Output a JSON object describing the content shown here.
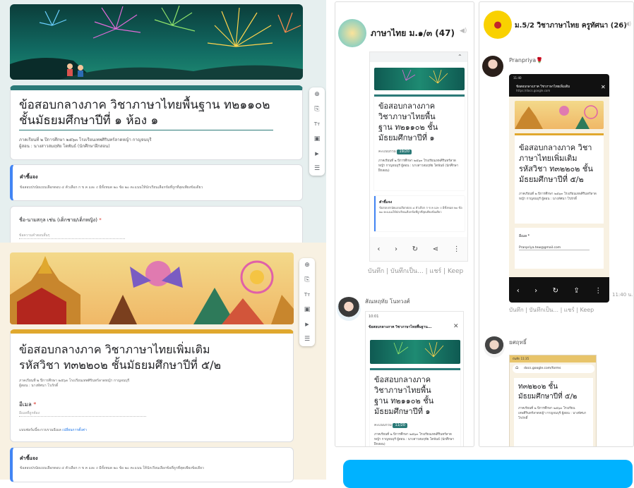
{
  "formA": {
    "title": "ข้อสอบกลางภาค วิชาภาษาไทยพื้นฐาน ท๒๑๑๐๒ ชั้นมัธยมศึกษาปีที่ ๑ ห้อง ๑",
    "title_line1": "ข้อสอบกลางภาค วิชาภาษาไทยพื้นฐาน ท๒๑๑๐๒",
    "title_line2": "ชั้นมัธยมศึกษาปีที่ ๑ ห้อง ๑",
    "desc1": "ภาคเรียนที่ ๒ ปีการศึกษา ๒๕๖๓ โรงเรียนเทพศิรินทร์ลาดหญ้า กาญจนบุรี",
    "desc2": "ผู้สอน : นางสาวสมฤทัย โตพันธ์ (นักศึกษาฝึกสอน)",
    "instr_title": "คำชี้แจง",
    "instr_text": "ข้อสอบปรนัยแบบเลือกตอบ ๔ ตัวเลือก ก ข ค และ ง มีทั้งหมด ๒๐ ข้อ ๒๐ คะแนนให้นักเรียนเลือกข้อที่ถูกที่สุดเพียงข้อเดียว",
    "q1_label": "ชื่อ-นามสกุล เช่น (เด็กชาย/เด็กหญิง)",
    "q1_placeholder": "ข้อความคำตอบสั้นๆ",
    "required_mark": "*"
  },
  "formB": {
    "title_line1": "ข้อสอบกลางภาค วิชาภาษาไทยเพิ่มเติม",
    "title_line2": "รหัสวิชา ท๓๒๒๐๒ ชั้นมัธยมศึกษาปีที่ ๕/๒",
    "desc1": "ภาคเรียนที่ ๒ ปีการศึกษา ๒๕๖๓ โรงเรียนเทพศิรินทร์ลาดหญ้า กาญจนบุรี",
    "desc2": "ผู้สอน : นางทัศนา โรภักดิ์",
    "email_label": "อีเมล",
    "email_placeholder": "อีเมลที่ถูกต้อง",
    "email_note": "แบบฟอร์มนี้จะรวบรวมอีเมล",
    "email_link": "เปลี่ยนการตั้งค่า",
    "instr_title": "คำชี้แจง",
    "instr_text": "ข้อสอบปรนัยแบบเลือกตอบ ๔ ตัวเลือก ก ข ค และ ง มีทั้งหมด ๒๐ ข้อ ๒๐ คะแนน ให้นักเรียนเลือกข้อที่ถูกที่สุดเพียงข้อเดียว",
    "required_mark": "*"
  },
  "toolbar_icons": [
    "add-question-icon",
    "import-questions-icon",
    "add-title-icon",
    "add-image-icon",
    "add-video-icon",
    "add-section-icon"
  ],
  "toolbar_glyphs": [
    "⊕",
    "⎘",
    "Tт",
    "▣",
    "▶",
    "☰"
  ],
  "chat1": {
    "group_name": "ภาษาไทย ม.๑/๓ (47)",
    "phone1_title_l1": "ข้อสอบกลางภาค",
    "phone1_title_l2": "วิชาภาษาไทยพื้น",
    "phone1_title_l3": "ฐาน ท๒๑๑๐๒ ชั้น",
    "phone1_title_l4": "มัธยมศึกษาปีที่ ๑",
    "score_label": "คะแนนรวม",
    "score1": "19/20",
    "phone1_desc": "ภาคเรียนที่ ๒ ปีการศึกษา ๒๕๖๓ โรงเรียนเทพศิรินทร์ลาดหญ้า กาญจนบุรี ผู้สอน : นางสาวสมฤทัย โตพันธ์ (นักศึกษาฝึกสอน)",
    "phone1_instr_title": "คำชี้แจง",
    "phone1_instr": "ข้อสอบปรนัยแบบเลือกตอบ ๔ ตัวเลือก ก ข ค และ ง มีทั้งหมด ๒๐ ข้อ ๒๐ คะแนนให้นักเรียนเลือกข้อที่ถูกที่สุดเพียงข้อเดียว",
    "actions": "บันทึก | บันทึกเป็น... | แชร์ | Keep",
    "sender2": "สัณหฤทัย โนทวงศ์",
    "phone2_time": "10:01",
    "phone2_header": "ข้อสอบกลางภาค วิชาภาษาไทยพื้นฐาน...",
    "score2": "11/20"
  },
  "chat2": {
    "group_name": "ม.5/2 วิชาภาษาไทย ครูทัศนา (26)",
    "sender1": "Pranpriya🌹",
    "phone_status": "11:40",
    "phone_header": "ข้อสอบกลางภาค วิชาภาษาไทยเพิ่มเติม",
    "phone_url": "https://docs.google.com",
    "form_title_l1": "ข้อสอบกลางภาค วิชา",
    "form_title_l2": "ภาษาไทยเพิ่มเติม",
    "form_title_l3": "รหัสวิชา ท๓๒๒๐๒ ชั้น",
    "form_title_l4": "มัธยมศึกษาปีที่ ๕/๒",
    "form_desc": "ภาคเรียนที่ ๒ ปีการศึกษา ๒๕๖๓ โรงเรียนเทพศิรินทร์ลาดหญ้า กาญจนบุรี ผู้สอน : นางทัศนา โรภักดิ์",
    "email_label": "อีเมล *",
    "email_value": "Pranpriya.tew@gmail.com",
    "time": "11:40 น.",
    "actions": "บันทึก | บันทึกเป็น... | แชร์ | Keep",
    "sender2": "ยศฤทธิ์",
    "phone2_status": "บันทึก 11:35",
    "phone2_url": "docs.google.com/forms",
    "phone2_title_l1": "ท๓๒๒๐๒ ชั้น",
    "phone2_title_l2": "มัธยมศึกษาปีที่ ๕/๒",
    "phone2_desc": "ภาคเรียนที่ ๒ ปีการศึกษา ๒๕๖๓ โรงเรียนเทพศิรินทร์ลาดหญ้า กาญจนบุรี ผู้สอน : นางทัศนา โรภักดิ์"
  },
  "colors": {
    "accentA": "#2b7a78",
    "accentB": "#e0a82e",
    "lineBlue": "#00b2ff"
  }
}
